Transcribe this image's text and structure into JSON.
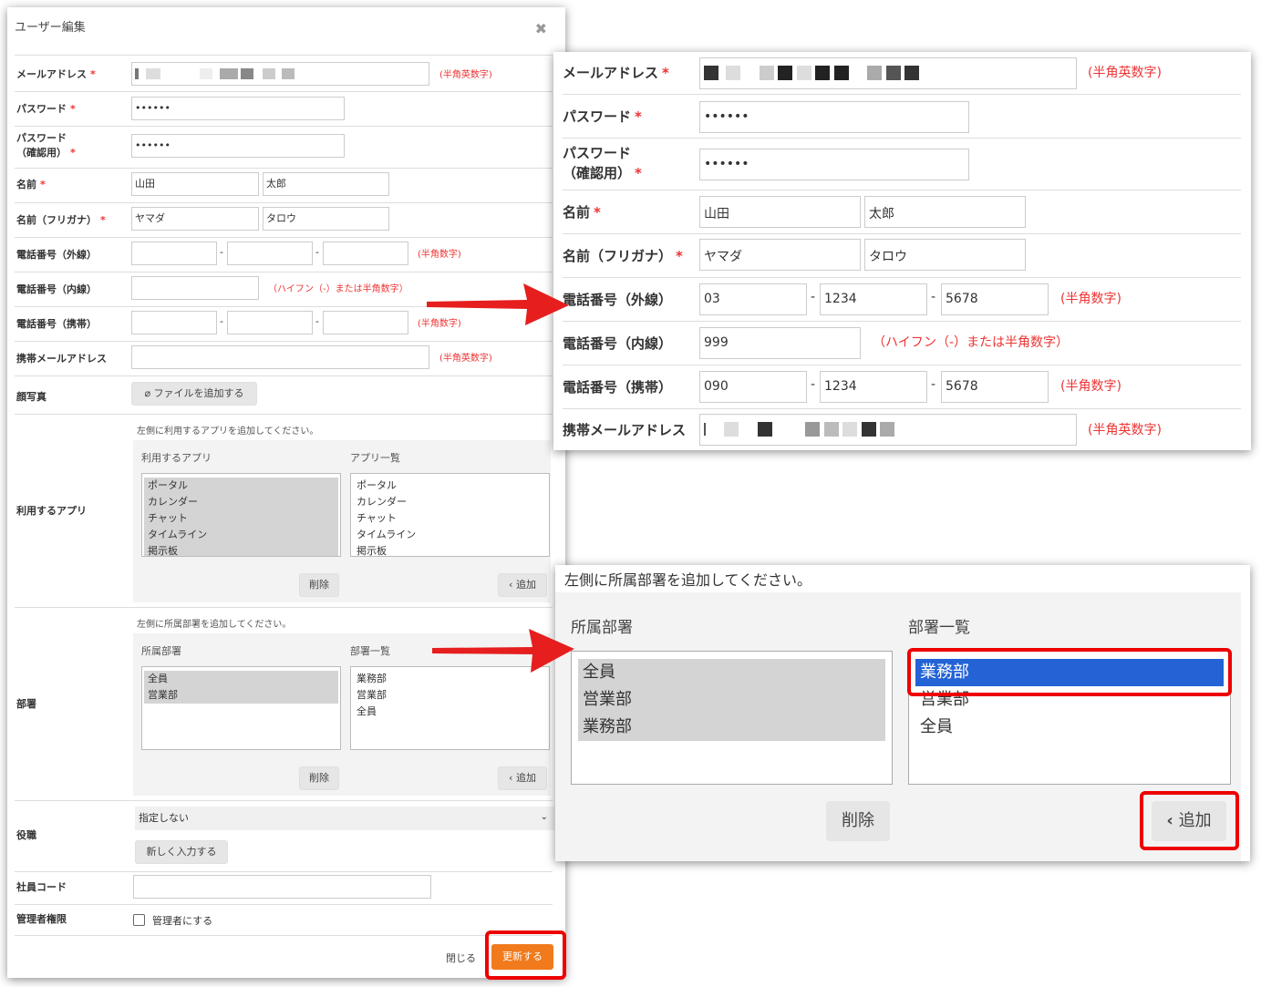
{
  "modal": {
    "title": "ユーザー編集",
    "close_icon": "✖",
    "fields": {
      "email": {
        "label": "メールアドレス",
        "req": "*",
        "hint": "(半角英数字)"
      },
      "password": {
        "label": "パスワード",
        "req": "*",
        "value": "••••••"
      },
      "password_confirm": {
        "label1": "パスワード",
        "label2": "（確認用）",
        "req": "*",
        "value": "••••••"
      },
      "name": {
        "label": "名前",
        "req": "*",
        "last": "山田",
        "first": "太郎"
      },
      "kana": {
        "label": "名前（フリガナ）",
        "req": "*",
        "last": "ヤマダ",
        "first": "タロウ"
      },
      "tel_ext": {
        "label": "電話番号（外線）",
        "hint": "(半角数字)",
        "sep": "-"
      },
      "tel_int": {
        "label": "電話番号（内線）",
        "hint": "（ハイフン（-）または半角数字）"
      },
      "tel_mobile": {
        "label": "電話番号（携帯）",
        "hint": "(半角数字)",
        "sep": "-"
      },
      "mobile_email": {
        "label": "携帯メールアドレス",
        "hint": "(半角英数字)"
      },
      "photo": {
        "label": "顔写真",
        "button": "ファイルを追加する"
      },
      "apps": {
        "label": "利用するアプリ",
        "note": "左側に利用するアプリを追加してください。",
        "left_title": "利用するアプリ",
        "right_title": "アプリ一覧",
        "left_items": [
          "ポータル",
          "カレンダー",
          "チャット",
          "タイムライン",
          "掲示板"
        ],
        "right_items": [
          "ポータル",
          "カレンダー",
          "チャット",
          "タイムライン",
          "掲示板"
        ],
        "delete": "削除",
        "add": "追加"
      },
      "dept": {
        "label": "部署",
        "note": "左側に所属部署を追加してください。",
        "left_title": "所属部署",
        "right_title": "部署一覧",
        "left_items": [
          "全員",
          "営業部"
        ],
        "right_items": [
          "業務部",
          "営業部",
          "全員"
        ],
        "delete": "削除",
        "add": "追加"
      },
      "position": {
        "label": "役職",
        "select": "指定しない",
        "button": "新しく入力する"
      },
      "employee_code": {
        "label": "社員コード"
      },
      "admin": {
        "label": "管理者権限",
        "checkbox": "管理者にする"
      }
    },
    "footer": {
      "close": "閉じる",
      "update": "更新する"
    }
  },
  "zoom1": {
    "email": {
      "label": "メールアドレス",
      "req": "*",
      "hint": "(半角英数字)"
    },
    "password": {
      "label": "パスワード",
      "req": "*",
      "value": "••••••"
    },
    "password_confirm": {
      "label1": "パスワード",
      "label2": "（確認用）",
      "req": "*",
      "value": "••••••"
    },
    "name": {
      "label": "名前",
      "req": "*",
      "last": "山田",
      "first": "太郎"
    },
    "kana": {
      "label": "名前（フリガナ）",
      "req": "*",
      "last": "ヤマダ",
      "first": "タロウ"
    },
    "tel_ext": {
      "label": "電話番号（外線）",
      "v1": "03",
      "v2": "1234",
      "v3": "5678",
      "hint": "(半角数字)",
      "sep": "-"
    },
    "tel_int": {
      "label": "電話番号（内線）",
      "v1": "999",
      "hint": "（ハイフン（-）または半角数字）"
    },
    "tel_mobile": {
      "label": "電話番号（携帯）",
      "v1": "090",
      "v2": "1234",
      "v3": "5678",
      "hint": "(半角数字)",
      "sep": "-"
    },
    "mobile_email": {
      "label": "携帯メールアドレス",
      "hint": "(半角英数字)"
    }
  },
  "zoom2": {
    "note": "左側に所属部署を追加してください。",
    "left_title": "所属部署",
    "right_title": "部署一覧",
    "left_items": [
      "全員",
      "営業部",
      "業務部"
    ],
    "right_items": [
      "業務部",
      "営業部",
      "全員"
    ],
    "delete": "削除",
    "add": "追加",
    "chevron_icon": "‹"
  },
  "colors": {
    "required": "#e33333",
    "update_button": "#f07a1c",
    "highlight_box": "#ee0000",
    "selection": "#2463d6",
    "arrow": "#e61e1e"
  }
}
